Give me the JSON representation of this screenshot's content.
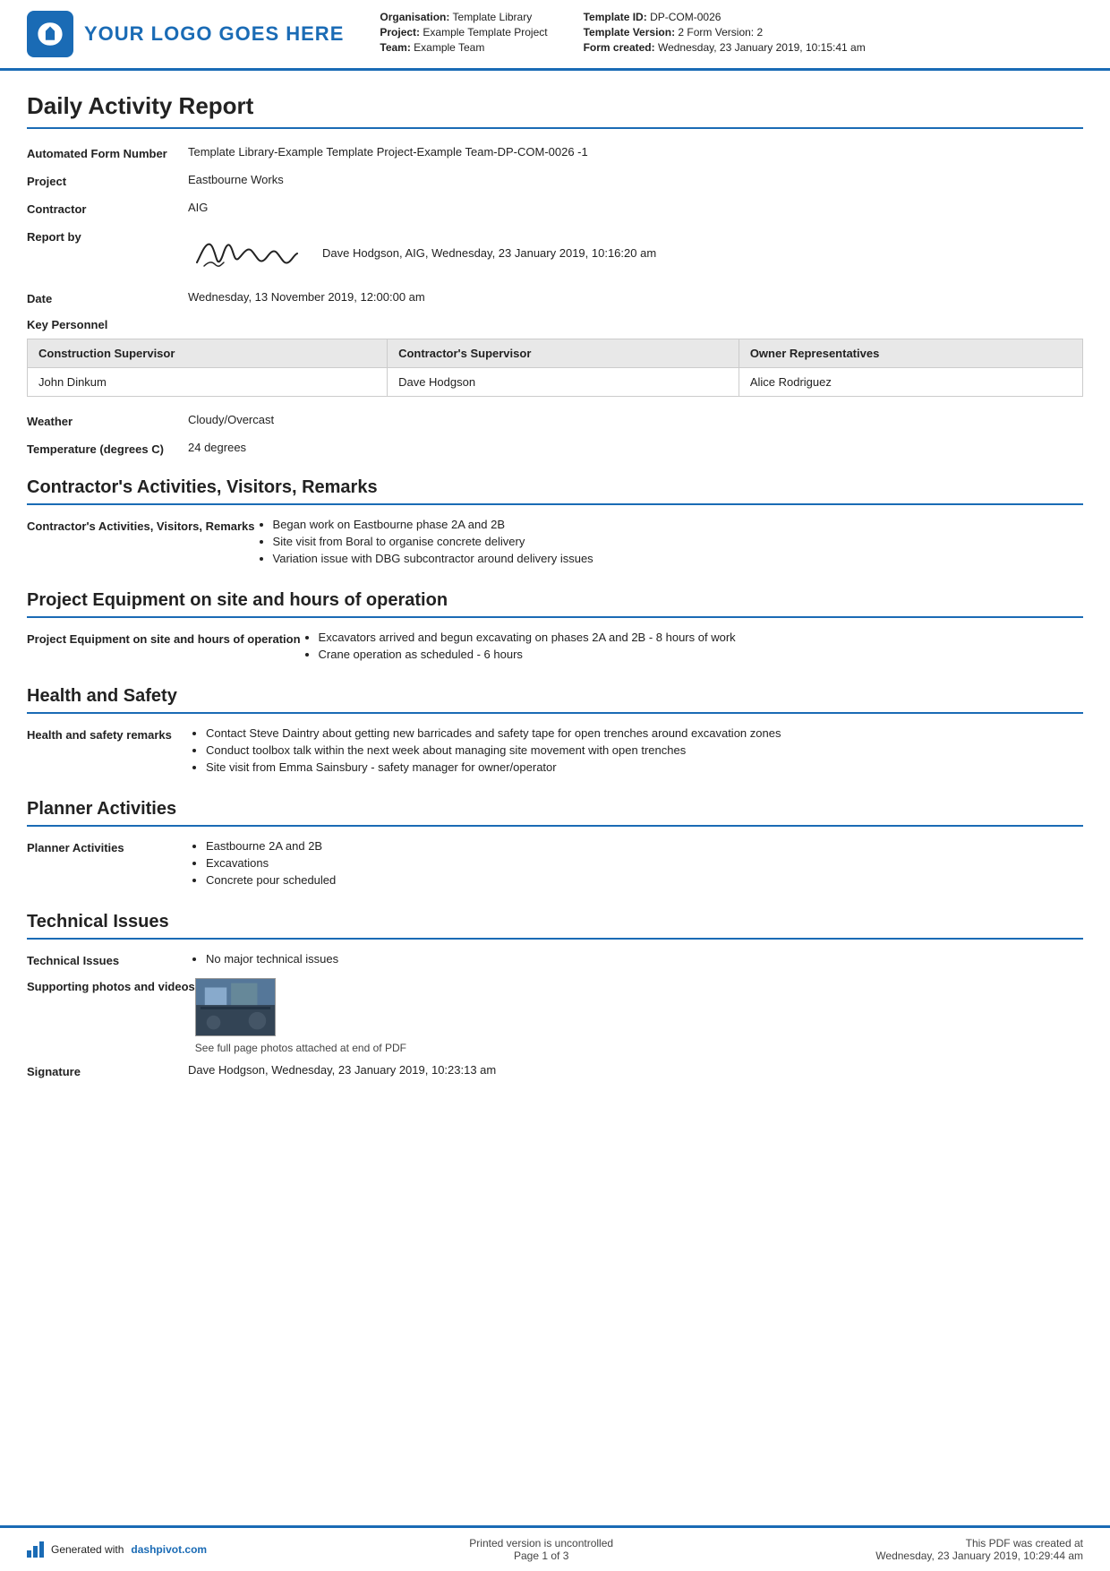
{
  "header": {
    "logo_text": "YOUR LOGO GOES HERE",
    "org_label": "Organisation:",
    "org_value": "Template Library",
    "project_label": "Project:",
    "project_value": "Example Template Project",
    "team_label": "Team:",
    "team_value": "Example Team",
    "template_id_label": "Template ID:",
    "template_id_value": "DP-COM-0026",
    "template_version_label": "Template Version:",
    "template_version_value": "2 Form Version: 2",
    "form_created_label": "Form created:",
    "form_created_value": "Wednesday, 23 January 2019, 10:15:41 am"
  },
  "report": {
    "title": "Daily Activity Report",
    "automated_form_label": "Automated Form Number",
    "automated_form_value": "Template Library-Example Template Project-Example Team-DP-COM-0026   -1",
    "project_label": "Project",
    "project_value": "Eastbourne Works",
    "contractor_label": "Contractor",
    "contractor_value": "AIG",
    "report_by_label": "Report by",
    "report_by_value": "Dave Hodgson, AIG, Wednesday, 23 January 2019, 10:16:20 am",
    "date_label": "Date",
    "date_value": "Wednesday, 13 November 2019, 12:00:00 am",
    "key_personnel_label": "Key Personnel",
    "personnel_table": {
      "headers": [
        "Construction Supervisor",
        "Contractor's Supervisor",
        "Owner Representatives"
      ],
      "row": [
        "John Dinkum",
        "Dave Hodgson",
        "Alice Rodriguez"
      ]
    },
    "weather_label": "Weather",
    "weather_value": "Cloudy/Overcast",
    "temperature_label": "Temperature (degrees C)",
    "temperature_value": "24 degrees"
  },
  "sections": {
    "contractors": {
      "title": "Contractor's Activities, Visitors, Remarks",
      "field_label": "Contractor's Activities, Visitors, Remarks",
      "items": [
        "Began work on Eastbourne phase 2A and 2B",
        "Site visit from Boral to organise concrete delivery",
        "Variation issue with DBG subcontractor around delivery issues"
      ]
    },
    "equipment": {
      "title": "Project Equipment on site and hours of operation",
      "field_label": "Project Equipment on site and hours of operation",
      "items": [
        "Excavators arrived and begun excavating on phases 2A and 2B - 8 hours of work",
        "Crane operation as scheduled - 6 hours"
      ]
    },
    "health_safety": {
      "title": "Health and Safety",
      "field_label": "Health and safety remarks",
      "items": [
        "Contact Steve Daintry about getting new barricades and safety tape for open trenches around excavation zones",
        "Conduct toolbox talk within the next week about managing site movement with open trenches",
        "Site visit from Emma Sainsbury - safety manager for owner/operator"
      ]
    },
    "planner": {
      "title": "Planner Activities",
      "field_label": "Planner Activities",
      "items": [
        "Eastbourne 2A and 2B",
        "Excavations",
        "Concrete pour scheduled"
      ]
    },
    "technical": {
      "title": "Technical Issues",
      "field_label": "Technical Issues",
      "items": [
        "No major technical issues"
      ],
      "supporting_label": "Supporting photos and videos",
      "photo_caption": "See full page photos attached at end of PDF",
      "signature_label": "Signature",
      "signature_value": "Dave Hodgson, Wednesday, 23 January 2019, 10:23:13 am"
    }
  },
  "footer": {
    "generated_text": "Generated with ",
    "link_text": "dashpivot.com",
    "uncontrolled_text": "Printed version is uncontrolled",
    "page_text": "Page 1 of 3",
    "pdf_created_text": "This PDF was created at",
    "pdf_created_date": "Wednesday, 23 January 2019, 10:29:44 am"
  }
}
